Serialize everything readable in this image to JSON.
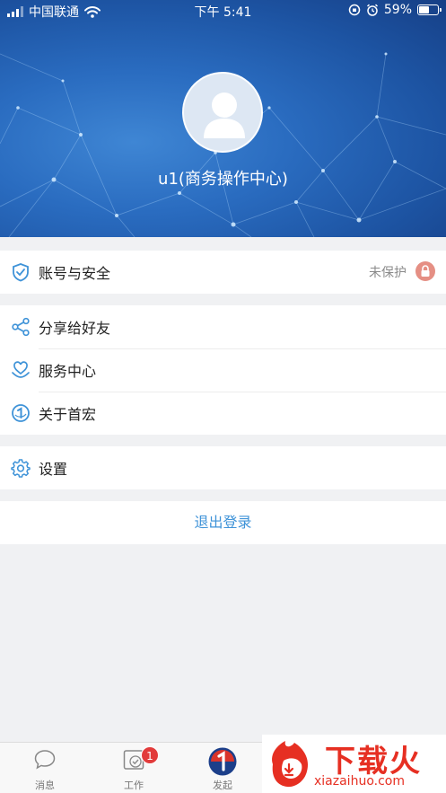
{
  "status_bar": {
    "carrier": "中国联通",
    "time": "下午 5:41",
    "battery_percent": "59%",
    "battery_level": 0.59
  },
  "profile": {
    "username": "u1(商务操作中心)"
  },
  "menu": {
    "account": {
      "label": "账号与安全",
      "status": "未保护",
      "icon": "shield-check-icon"
    },
    "share": {
      "label": "分享给好友",
      "icon": "share-icon"
    },
    "service": {
      "label": "服务中心",
      "icon": "heart-hands-icon"
    },
    "about": {
      "label": "关于首宏",
      "icon": "brand-logo-icon"
    },
    "settings": {
      "label": "设置",
      "icon": "gear-icon"
    }
  },
  "logout_label": "退出登录",
  "tabbar": {
    "messages": "消息",
    "work": "工作",
    "work_badge": "1",
    "launch": "发起"
  },
  "watermark": {
    "title": "下载火",
    "url": "xiazaihuo.com"
  },
  "colors": {
    "accent": "#3f93d8",
    "header_blue": "#2a6cc0",
    "badge_red": "#e23b3b",
    "lock_pink": "#e58f84"
  }
}
